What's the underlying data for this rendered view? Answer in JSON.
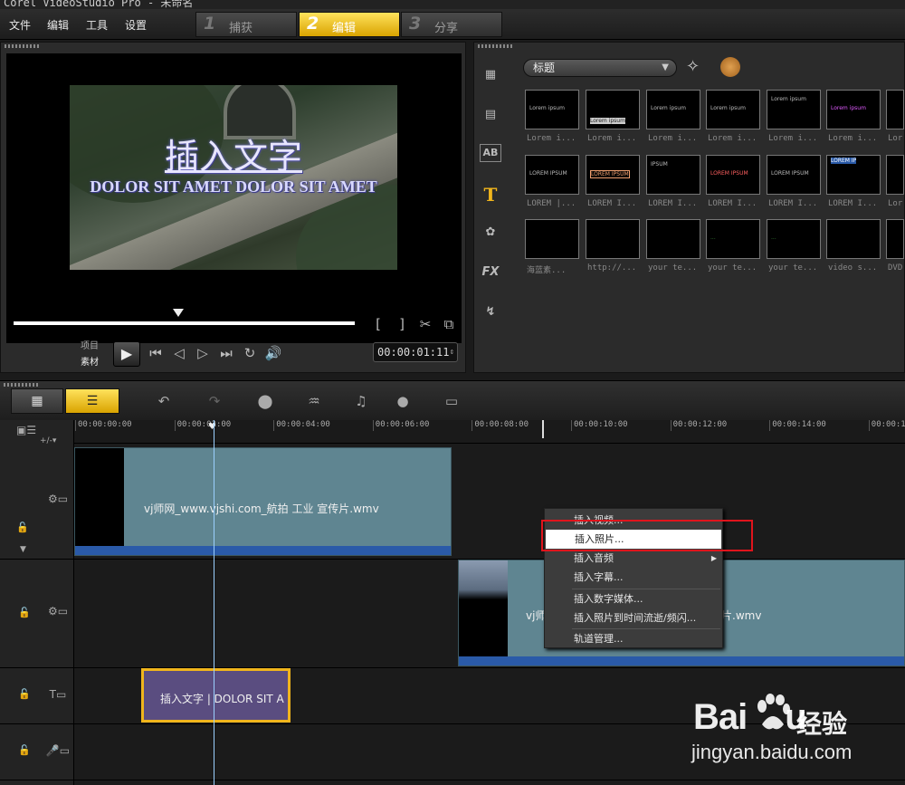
{
  "app": {
    "title": "Corel VideoStudio Pro - 未命名"
  },
  "menu": {
    "items": [
      "文件",
      "编辑",
      "工具",
      "设置"
    ]
  },
  "steps": [
    {
      "num": "1",
      "label": "捕获"
    },
    {
      "num": "2",
      "label": "编辑"
    },
    {
      "num": "3",
      "label": "分享"
    }
  ],
  "preview": {
    "overlay_line1": "插入文字",
    "overlay_line2": "DOLOR SIT AMET DOLOR SIT AMET",
    "mode_project": "项目",
    "mode_clip": "素材",
    "timecode": "00:00:01:11"
  },
  "library": {
    "category": "标题",
    "side_icons": [
      "media-icon",
      "transition-icon",
      "ab-icon",
      "title-icon",
      "graphic-icon",
      "fx-icon",
      "path-icon"
    ],
    "fx_label": "FX",
    "ab_label": "AB",
    "title_icon_label": "T",
    "thumbs_row1": [
      "Lorem i...",
      "Lorem i...",
      "Lorem i...",
      "Lorem i...",
      "Lorem i...",
      "Lorem i...",
      "Lor"
    ],
    "thumbs_row2": [
      "LOREM |...",
      "LOREM I...",
      "LOREM I...",
      "LOREM I...",
      "LOREM I...",
      "LOREM I...",
      "Lor"
    ],
    "thumbs_row3": [
      "海蓝素...",
      "http://...",
      "your te...",
      "your te...",
      "your te...",
      "video s...",
      "DVD"
    ]
  },
  "ruler": {
    "ticks": [
      "00:00:00:00",
      "00:00:02:00",
      "00:00:04:00",
      "00:00:06:00",
      "00:00:08:00",
      "00:00:10:00",
      "00:00:12:00",
      "00:00:14:00",
      "00:00:16"
    ]
  },
  "tracks": {
    "video_clip_name": "vj师网_www.vjshi.com_航拍 工业 宣传片.wmv",
    "overlay_clip_left": "vj师",
    "overlay_clip_right": "片.wmv",
    "title_clip": "插入文字 | DOLOR SIT A"
  },
  "context_menu": {
    "items": [
      "插入视频...",
      "插入照片...",
      "插入音频",
      "插入字幕...",
      "插入数字媒体...",
      "插入照片到时间流逝/频闪...",
      "轨道管理..."
    ],
    "highlighted": "插入照片..."
  },
  "watermark": {
    "logo": "Bai",
    "logo2": "u",
    "cn": "经验",
    "url": "jingyan.baidu.com"
  },
  "colors": {
    "accent": "#f0b51c",
    "highlight_box": "#e0141c",
    "clip": "#5f8591",
    "title_clip": "#5a4d80"
  }
}
